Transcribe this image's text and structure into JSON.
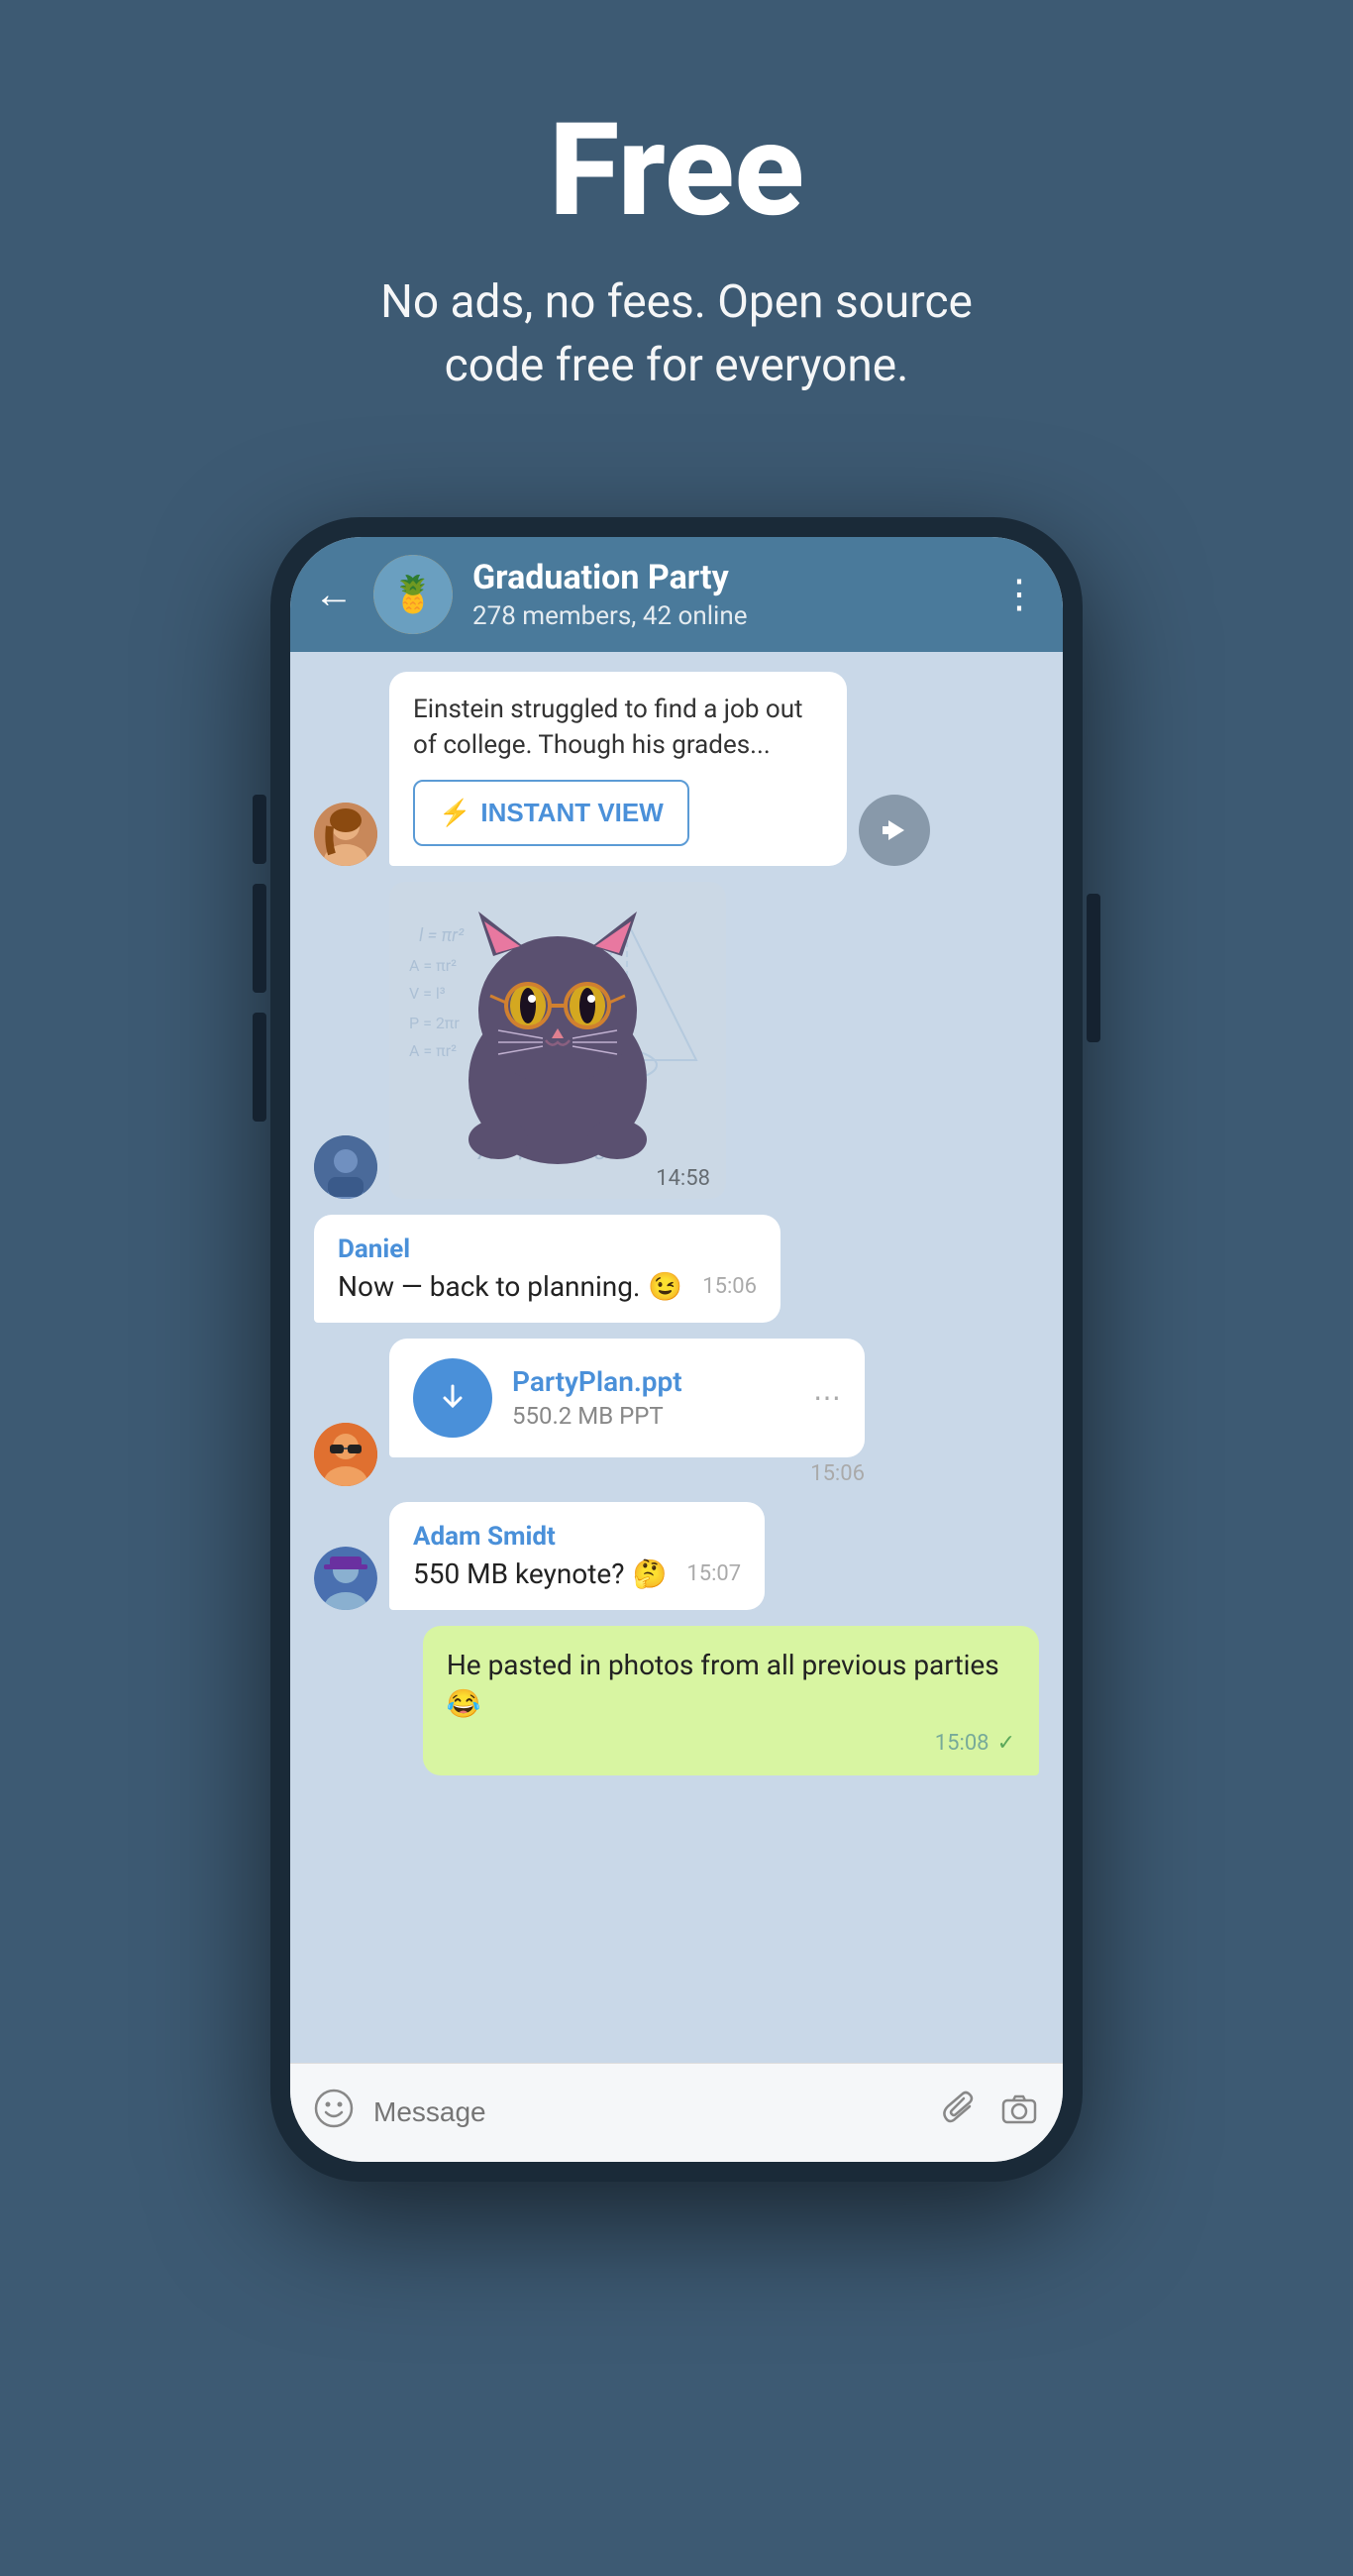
{
  "hero": {
    "title": "Free",
    "subtitle": "No ads, no fees. Open source code free for everyone."
  },
  "chat": {
    "header": {
      "back_label": "←",
      "group_name": "Graduation Party",
      "group_status": "278 members, 42 online",
      "menu_label": "⋮"
    },
    "messages": [
      {
        "id": "instant-view-msg",
        "type": "instant_view",
        "text": "Einstein struggled to find a job out of college. Though his grades...",
        "button_label": "INSTANT VIEW",
        "timestamp": null
      },
      {
        "id": "sticker-msg",
        "type": "sticker",
        "timestamp": "14:58"
      },
      {
        "id": "daniel-msg",
        "type": "text",
        "sender": "Daniel",
        "text": "Now — back to planning.",
        "emoji": "😉",
        "timestamp": "15:06"
      },
      {
        "id": "file-msg",
        "type": "file",
        "file_name": "PartyPlan.ppt",
        "file_size": "550.2 MB PPT",
        "timestamp": "15:06"
      },
      {
        "id": "adam-msg",
        "type": "text",
        "sender": "Adam Smidt",
        "text": "550 MB keynote?",
        "emoji": "🤔",
        "timestamp": "15:07"
      },
      {
        "id": "own-msg",
        "type": "own",
        "text": "He pasted in photos from all previous parties 😂",
        "timestamp": "15:08"
      }
    ],
    "input": {
      "placeholder": "Message",
      "emoji_icon": "emoji",
      "attach_icon": "paperclip",
      "camera_icon": "camera"
    }
  },
  "colors": {
    "background": "#3d5a73",
    "header_blue": "#4a7a9b",
    "chat_bg": "#c9d8e8",
    "accent_blue": "#4a90d9",
    "own_bubble": "#d8f5a2",
    "white": "#ffffff"
  }
}
